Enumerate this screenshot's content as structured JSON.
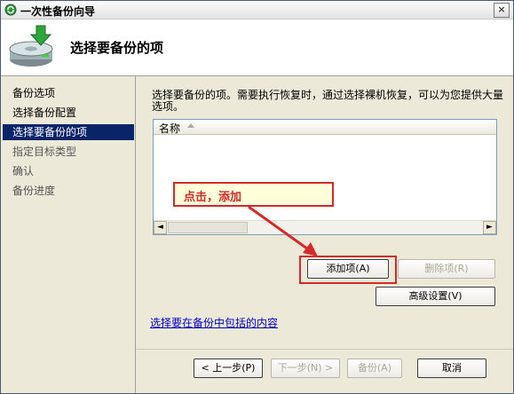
{
  "window": {
    "title": "一次性备份向导",
    "close_glyph": "×"
  },
  "header": {
    "title": "选择要备份的项"
  },
  "nav": {
    "items": [
      {
        "label": "备份选项",
        "state": "done"
      },
      {
        "label": "选择备份配置",
        "state": "done"
      },
      {
        "label": "选择要备份的项",
        "state": "selected"
      },
      {
        "label": "指定目标类型",
        "state": "pending"
      },
      {
        "label": "确认",
        "state": "pending"
      },
      {
        "label": "备份进度",
        "state": "pending"
      }
    ]
  },
  "main": {
    "description": "选择要备份的项。需要执行恢复时，通过选择裸机恢复，可以为您提供大量选项。",
    "list": {
      "column_header": "名称",
      "rows": []
    },
    "scroll_left_glyph": "◄",
    "scroll_right_glyph": "►",
    "add_button": "添加项(A)",
    "remove_button": "删除项(R)",
    "advanced_button": "高级设置(V)",
    "exclude_link": "选择要在备份中包括的内容"
  },
  "footer": {
    "prev_button": "< 上一步(P)",
    "next_button": "下一步(N) >",
    "backup_button": "备份(A)",
    "cancel_button": "取消"
  },
  "annotation": {
    "text": "点击，添加",
    "color": "#d62a2a",
    "background": "#ffffd9"
  },
  "icons": {
    "title_icon": "wizard-recycle-icon",
    "header_icon": "backup-drive-icon",
    "sort_icon": "sort-ascending-icon"
  },
  "colors": {
    "selection": "#0a246a",
    "link": "#0000cc"
  }
}
